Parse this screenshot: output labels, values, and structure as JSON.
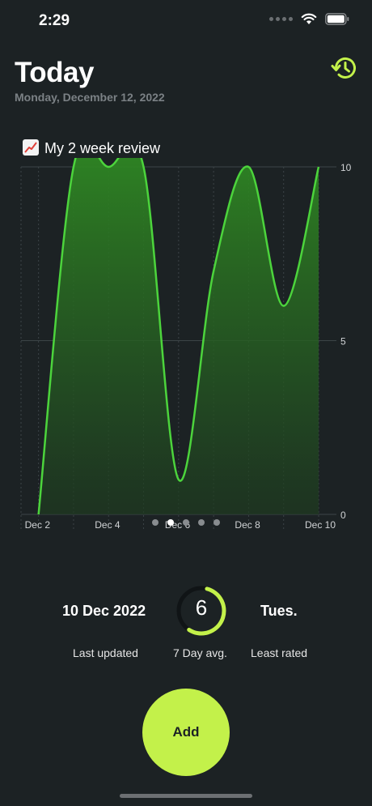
{
  "status_bar": {
    "time": "2:29"
  },
  "header": {
    "title": "Today",
    "date": "Monday, December 12, 2022",
    "history_icon": "history-icon",
    "accent": "#c3f14a"
  },
  "chart_title": "My 2 week review",
  "chart_data": {
    "type": "area",
    "title": "My 2 week review",
    "x_tick_labels": [
      "Dec 2",
      "Dec 4",
      "Dec 6",
      "Dec 8",
      "Dec 10"
    ],
    "y_tick_labels": [
      "10",
      "5",
      "0"
    ],
    "ylim": [
      0,
      10
    ],
    "series": [
      {
        "color": "#4cd43c",
        "points": [
          {
            "x": 2,
            "y": 0
          },
          {
            "x": 3,
            "y": 10
          },
          {
            "x": 4,
            "y": 10
          },
          {
            "x": 5,
            "y": 10
          },
          {
            "x": 6,
            "y": 1
          },
          {
            "x": 7,
            "y": 7
          },
          {
            "x": 8,
            "y": 10
          },
          {
            "x": 9,
            "y": 6
          },
          {
            "x": 10,
            "y": 10
          }
        ]
      }
    ],
    "grid": true,
    "y_axis_side": "right"
  },
  "pager": {
    "count": 5,
    "active": 1
  },
  "stats": {
    "last_updated": {
      "value": "10 Dec 2022",
      "label": "Last updated"
    },
    "avg": {
      "value": "6",
      "label": "7 Day avg.",
      "fraction": 0.6
    },
    "least_rated": {
      "value": "Tues.",
      "label": "Least rated"
    }
  },
  "add_button": {
    "label": "Add"
  }
}
